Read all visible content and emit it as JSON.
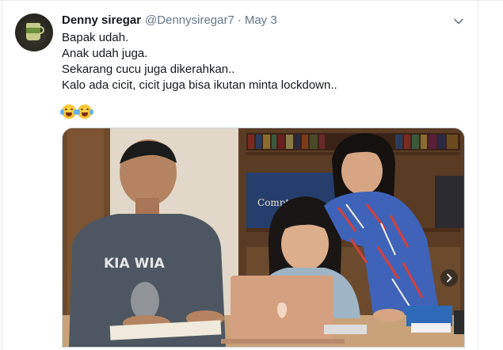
{
  "tweet": {
    "display_name": "Denny siregar",
    "handle": "@Dennysiregar7",
    "separator": "·",
    "date": "May 3",
    "lines": [
      "Bapak udah.",
      "Anak udah juga.",
      "Sekarang cucu juga dikerahkan..",
      "Kalo ada cicit, cicit juga bisa ikutan minta lockdown.."
    ],
    "emojis": [
      "face-with-tears-of-joy-icon",
      "face-with-tears-of-joy-icon"
    ]
  },
  "media": {
    "photo_text": {
      "book_title": "Compton",
      "shirt_text": "KIA WIA"
    }
  },
  "icons": {
    "avatar": "avatar-mug-icon",
    "menu": "chevron-down-icon",
    "next": "chevron-right-icon"
  },
  "colors": {
    "text_primary": "#14171a",
    "text_secondary": "#657786",
    "border": "#e6ecf0"
  }
}
